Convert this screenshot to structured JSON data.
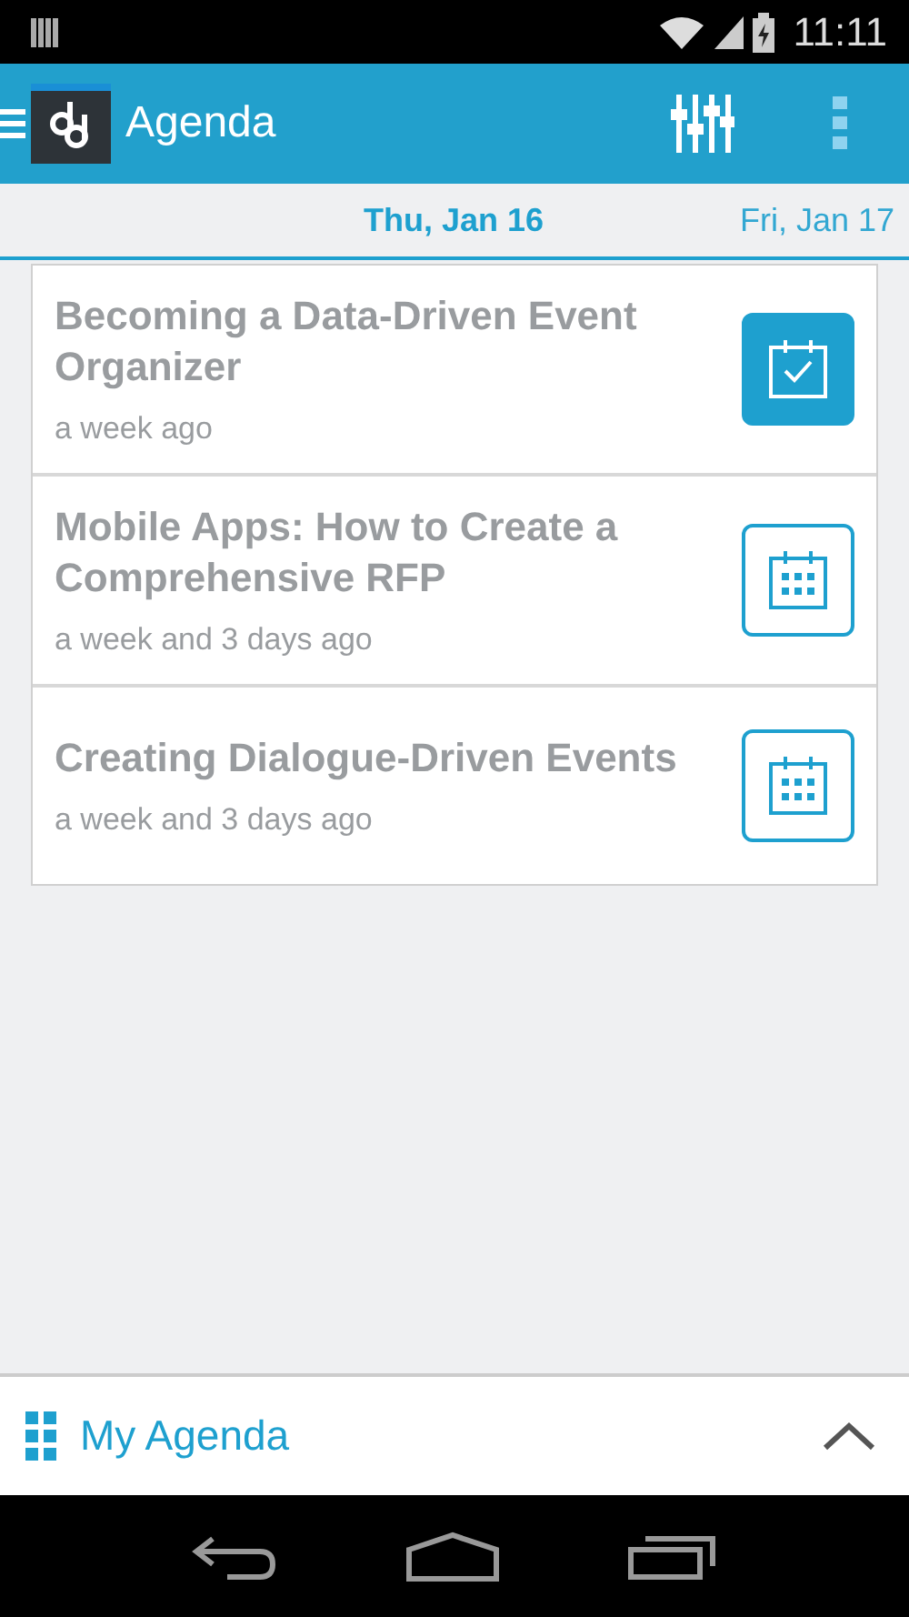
{
  "status_bar": {
    "time": "11:11"
  },
  "app_bar": {
    "title": "Agenda"
  },
  "days": [
    {
      "label": "Thu, Jan 16",
      "selected": true
    },
    {
      "label": "Fri, Jan 17",
      "selected": false
    }
  ],
  "sessions": [
    {
      "title": "Becoming a Data-Driven Event Organizer",
      "time": "a week ago",
      "added": true
    },
    {
      "title": "Mobile Apps: How to Create a Comprehensive RFP",
      "time": "a week and 3 days ago",
      "added": false
    },
    {
      "title": "Creating Dialogue-Driven Events",
      "time": "a week and 3 days ago",
      "added": false
    }
  ],
  "bottom_bar": {
    "label": "My Agenda",
    "expanded": false
  }
}
